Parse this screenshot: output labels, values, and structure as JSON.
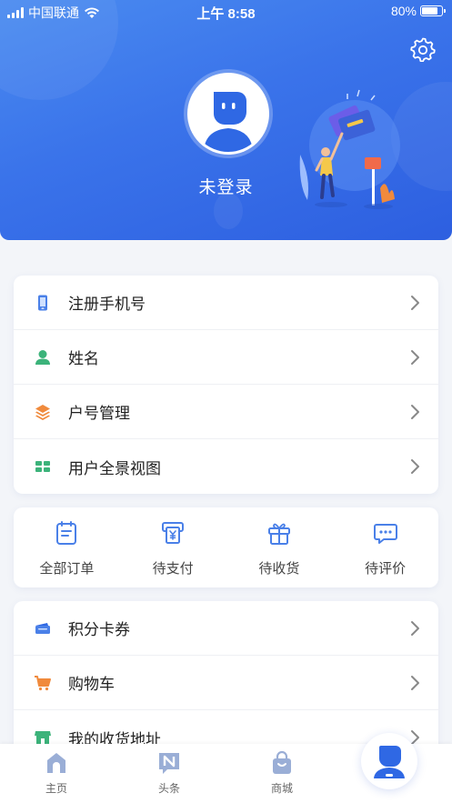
{
  "status_bar": {
    "carrier": "中国联通",
    "time": "上午 8:58",
    "battery": "80%",
    "battery_level": 0.8
  },
  "profile": {
    "login_label": "未登录"
  },
  "menu_primary": [
    {
      "label": "注册手机号",
      "icon": "phone-icon"
    },
    {
      "label": "姓名",
      "icon": "person-icon"
    },
    {
      "label": "户号管理",
      "icon": "layers-icon"
    },
    {
      "label": "用户全景视图",
      "icon": "grid-icon"
    }
  ],
  "orders": [
    {
      "label": "全部订单",
      "icon": "all-orders-icon"
    },
    {
      "label": "待支付",
      "icon": "pending-payment-icon"
    },
    {
      "label": "待收货",
      "icon": "pending-receipt-icon"
    },
    {
      "label": "待评价",
      "icon": "pending-review-icon"
    }
  ],
  "menu_secondary": [
    {
      "label": "积分卡券",
      "icon": "ticket-icon"
    },
    {
      "label": "购物车",
      "icon": "cart-icon"
    },
    {
      "label": "我的收货地址",
      "icon": "store-icon"
    }
  ],
  "tabbar": [
    {
      "label": "主页",
      "icon": "home-icon"
    },
    {
      "label": "头条",
      "icon": "news-icon"
    },
    {
      "label": "商城",
      "icon": "shop-bag-icon"
    },
    {
      "label": "",
      "icon": "profile-icon"
    }
  ],
  "colors": {
    "brand_blue": "#3a73ea",
    "icon_blue": "#4a80e8",
    "icon_green": "#3cb37a",
    "icon_orange": "#f08a3c",
    "tab_gray": "#9aaed6"
  }
}
